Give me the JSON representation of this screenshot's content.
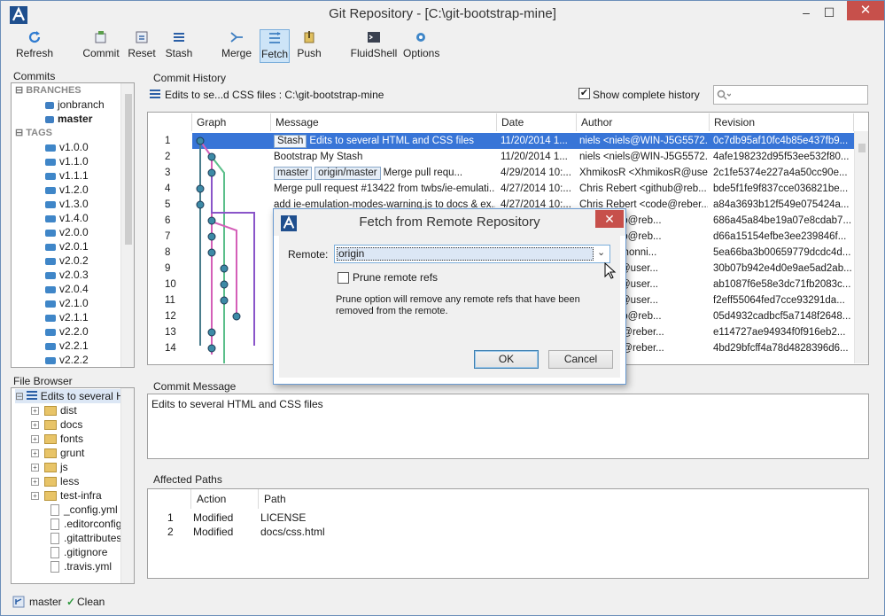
{
  "window": {
    "title": "Git Repository - [C:\\git-bootstrap-mine]",
    "min": "–",
    "max": "☐",
    "close": "✕"
  },
  "toolbar": [
    {
      "label": "Refresh",
      "icon": "refresh-icon"
    },
    {
      "label": "Commit",
      "icon": "commit-icon"
    },
    {
      "label": "Reset",
      "icon": "reset-icon"
    },
    {
      "label": "Stash",
      "icon": "stash-icon"
    },
    {
      "label": "Merge",
      "icon": "merge-icon"
    },
    {
      "label": "Fetch",
      "icon": "fetch-icon"
    },
    {
      "label": "Push",
      "icon": "push-icon"
    },
    {
      "label": "FluidShell",
      "icon": "fluidshell-icon"
    },
    {
      "label": "Options",
      "icon": "gear-icon"
    }
  ],
  "commits": {
    "label": "Commits",
    "branches_head": "BRANCHES",
    "branches": [
      "jonbranch",
      "master"
    ],
    "tags_head": "TAGS",
    "tags": [
      "v1.0.0",
      "v1.1.0",
      "v1.1.1",
      "v1.2.0",
      "v1.3.0",
      "v1.4.0",
      "v2.0.0",
      "v2.0.1",
      "v2.0.2",
      "v2.0.3",
      "v2.0.4",
      "v2.1.0",
      "v2.1.1",
      "v2.2.0",
      "v2.2.1",
      "v2.2.2"
    ]
  },
  "file_browser": {
    "label": "File Browser",
    "root": "Edits to several H",
    "folders": [
      "dist",
      "docs",
      "fonts",
      "grunt",
      "js",
      "less",
      "test-infra"
    ],
    "files": [
      "_config.yml",
      ".editorconfig",
      ".gitattributes",
      ".gitignore",
      ".travis.yml"
    ]
  },
  "history": {
    "label": "Commit History",
    "path": "Edits to se...d CSS files : C:\\git-bootstrap-mine",
    "show_complete": "Show complete history",
    "columns": [
      "Graph",
      "Message",
      "Date",
      "Author",
      "Revision"
    ],
    "rows": [
      {
        "n": "1",
        "badges": [
          "Stash"
        ],
        "msg": "Edits to several HTML and CSS files",
        "date": "11/20/2014 1...",
        "author": "niels <niels@WIN-J5G5572...",
        "rev": "0c7db95af10fc4b85e437fb9..."
      },
      {
        "n": "2",
        "badges": [],
        "msg": "Bootstrap My Stash",
        "date": "11/20/2014 1...",
        "author": "niels <niels@WIN-J5G5572...",
        "rev": "4afe198232d95f53ee532f80..."
      },
      {
        "n": "3",
        "badges": [
          "master",
          "origin/master"
        ],
        "msg": "Merge pull requ...",
        "date": "4/29/2014 10:...",
        "author": "XhmikosR <XhmikosR@use...",
        "rev": "2c1fe5374e227a4a50cc90e..."
      },
      {
        "n": "4",
        "badges": [],
        "msg": "Merge pull request #13422 from twbs/ie-emulati...",
        "date": "4/27/2014 10:...",
        "author": "Chris Rebert <github@reb...",
        "rev": "bde5f1fe9f837cce036821be..."
      },
      {
        "n": "5",
        "badges": [],
        "msg": "add ie-emulation-modes-warning.js to docs & ex...",
        "date": "4/27/2014 10:...",
        "author": "Chris Rebert <code@reber...",
        "rev": "a84a3693b12f549e075424a..."
      },
      {
        "n": "6",
        "badges": [],
        "msg": "",
        "date": "",
        "author": "ert <github@reb...",
        "rev": "686a45a84be19a07e8cdab7..."
      },
      {
        "n": "7",
        "badges": [],
        "msg": "",
        "date": "",
        "author": "ert <github@reb...",
        "rev": "d66a15154efbe3ee239846f..."
      },
      {
        "n": "8",
        "badges": [],
        "msg": "",
        "date": "",
        "author": "ning <nschonni...",
        "rev": "5ea66ba3b00659779dcdc4d..."
      },
      {
        "n": "9",
        "badges": [],
        "msg": "",
        "date": "",
        "author": "xhmikosr@user...",
        "rev": "30b07b942e4d0e9ae5ad2ab..."
      },
      {
        "n": "10",
        "badges": [],
        "msg": "",
        "date": "",
        "author": "xhmikosr@user...",
        "rev": "ab1087f6e58e3dc71fb2083c..."
      },
      {
        "n": "11",
        "badges": [],
        "msg": "",
        "date": "",
        "author": "xhmikosr@user...",
        "rev": "f2eff55064fed7cce93291da..."
      },
      {
        "n": "12",
        "badges": [],
        "msg": "",
        "date": "",
        "author": "ert <github@reb...",
        "rev": "05d4932cadbcf5a7148f2648..."
      },
      {
        "n": "13",
        "badges": [],
        "msg": "",
        "date": "",
        "author": "ert <code@reber...",
        "rev": "e114727ae94934f0f916eb2..."
      },
      {
        "n": "14",
        "badges": [],
        "msg": "",
        "date": "",
        "author": "ert <code@reber...",
        "rev": "4bd29bfcff4a78d4828396d6..."
      }
    ]
  },
  "commit_message": {
    "label": "Commit Message",
    "text": "Edits to several HTML and CSS files"
  },
  "affected": {
    "label": "Affected Paths",
    "columns": [
      "Action",
      "Path"
    ],
    "rows": [
      {
        "n": "1",
        "action": "Modified",
        "path": "LICENSE"
      },
      {
        "n": "2",
        "action": "Modified",
        "path": "docs/css.html"
      }
    ]
  },
  "dialog": {
    "title": "Fetch from Remote Repository",
    "close": "✕",
    "remote_label": "Remote:",
    "remote_value": "origin",
    "prune_label": "Prune remote refs",
    "prune_checked": false,
    "note": "Prune option will remove any remote refs that have been removed from the remote.",
    "ok": "OK",
    "cancel": "Cancel"
  },
  "status": {
    "branch": "master",
    "state": "Clean"
  },
  "colors": {
    "accent": "#3875d7",
    "selection": "#3875d7",
    "close_red": "#c7504b",
    "graph_teal": "#4a7d8c",
    "graph_pink": "#d45fb8",
    "graph_green": "#5bbf8a",
    "graph_purple": "#8a55c9"
  }
}
